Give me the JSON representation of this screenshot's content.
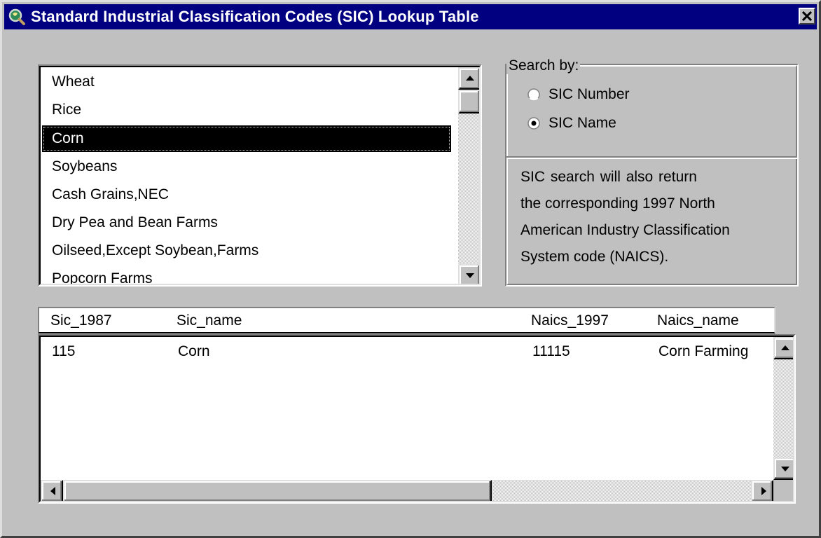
{
  "window": {
    "title": "Standard Industrial Classification Codes (SIC) Lookup Table"
  },
  "sic_list": {
    "items": [
      {
        "label": "Wheat"
      },
      {
        "label": "Rice"
      },
      {
        "label": "Corn"
      },
      {
        "label": "Soybeans"
      },
      {
        "label": "Cash Grains,NEC"
      },
      {
        "label": "Dry Pea and Bean Farms"
      },
      {
        "label": "Oilseed,Except Soybean,Farms"
      },
      {
        "label": "Popcorn Farms"
      }
    ],
    "selected_index": 2
  },
  "search_by": {
    "label": "Search by:",
    "options": [
      {
        "label": "SIC Number",
        "checked": false
      },
      {
        "label": "SIC Name",
        "checked": true
      }
    ],
    "description_lines": [
      "SIC  search  will  also  return",
      "the corresponding 1997 North",
      "American Industry Classification",
      "System code (NAICS)."
    ]
  },
  "results": {
    "columns": [
      "Sic_1987",
      "Sic_name",
      "Naics_1997",
      "Naics_name"
    ],
    "rows": [
      [
        "115",
        "Corn",
        "11115",
        "Corn Farming"
      ]
    ]
  },
  "icons": {
    "app": "globe-magnifier-icon",
    "close": "close-icon"
  }
}
